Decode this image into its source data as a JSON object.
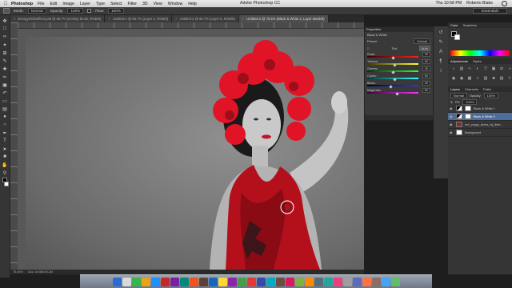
{
  "menubar": {
    "app_name": "Photoshop",
    "items": [
      "File",
      "Edit",
      "Image",
      "Layer",
      "Type",
      "Select",
      "Filter",
      "3D",
      "View",
      "Window",
      "Help"
    ],
    "window_title": "Adobe Photoshop CC",
    "clock": "Thu 10:58 PM",
    "user": "Roberto Blake"
  },
  "options_bar": {
    "mode_label": "Mode:",
    "mode_value": "Normal",
    "opacity_label": "Opacity:",
    "opacity_value": "100%",
    "flow_label": "Flow:",
    "flow_value": "100%",
    "workspace": "Essentials"
  },
  "tabs": [
    {
      "label": "EnergyDrinkEffect.psd @ 66.7% (overlay brush, RGB/8)",
      "active": false
    },
    {
      "label": "Untitled-1 @ 66.7% (Layer 4, RGB/8)",
      "active": false
    },
    {
      "label": "Untitled-2 @ 66.7% (Layer 6, RGB/8)",
      "active": false
    },
    {
      "label": "Untitled-2 @ 75.5% (Black & White 2, Layer Mask/8)",
      "active": true
    }
  ],
  "status": {
    "zoom": "75.44%",
    "doc": "Doc: 5.93M/39.2M"
  },
  "properties": {
    "header": "Properties",
    "title": "Black & White",
    "preset_label": "Preset:",
    "preset_value": "Default",
    "tint_label": "Tint",
    "auto_label": "Auto",
    "sliders": [
      {
        "label": "Reds:",
        "value": 40,
        "color_from": "#3a0000",
        "color_to": "#ff2020"
      },
      {
        "label": "Yellows:",
        "value": 60,
        "color_from": "#3a3a00",
        "color_to": "#ffff30"
      },
      {
        "label": "Greens:",
        "value": 40,
        "color_from": "#003a00",
        "color_to": "#30ff30"
      },
      {
        "label": "Cyans:",
        "value": 60,
        "color_from": "#003a3a",
        "color_to": "#30ffff"
      },
      {
        "label": "Blues:",
        "value": 20,
        "color_from": "#00003a",
        "color_to": "#3030ff"
      },
      {
        "label": "Magentas:",
        "value": 80,
        "color_from": "#3a003a",
        "color_to": "#ff30ff"
      }
    ]
  },
  "right_dock": {
    "color_tab": "Color",
    "swatches_tab": "Swatches",
    "adjustments_tab": "Adjustments",
    "styles_tab": "Styles",
    "layers_tab": "Layers",
    "channels_tab": "Channels",
    "paths_tab": "Paths",
    "blend_mode": "Normal",
    "opacity_label": "Opacity:",
    "opacity_value": "100%",
    "fill_label": "Fill:",
    "fill_value": "100%",
    "layers": [
      {
        "name": "Black & White 1",
        "active": false,
        "mask": true
      },
      {
        "name": "Black & White 2",
        "active": true,
        "mask": true
      },
      {
        "name": "red_poppy_dress_by_liber...",
        "active": false,
        "mask": false
      },
      {
        "name": "Background",
        "active": false,
        "mask": false
      }
    ]
  },
  "icons": {
    "toolbox": [
      "move-icon",
      "marquee-icon",
      "lasso-icon",
      "quick-select-icon",
      "crop-icon",
      "eyedropper-icon",
      "healing-icon",
      "brush-icon",
      "stamp-icon",
      "history-brush-icon",
      "eraser-icon",
      "gradient-icon",
      "blur-icon",
      "dodge-icon",
      "pen-icon",
      "type-icon",
      "path-select-icon",
      "shape-icon",
      "hand-icon",
      "zoom-icon"
    ]
  },
  "colors": {
    "accent_layer": "#4d6c99",
    "panel_bg": "#393939",
    "foreground": "#000000",
    "background": "#ffffff"
  }
}
